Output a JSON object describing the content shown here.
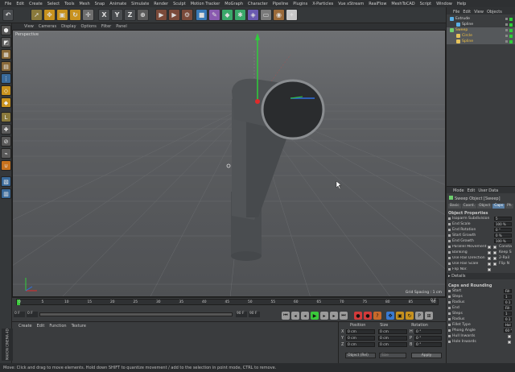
{
  "menu": [
    "File",
    "Edit",
    "Create",
    "Select",
    "Tools",
    "Mesh",
    "Snap",
    "Animate",
    "Simulate",
    "Render",
    "Sculpt",
    "Motion Tracker",
    "MoGraph",
    "Character",
    "Pipeline",
    "Plugins",
    "X-Particles",
    "Vue xStream",
    "RealFlow",
    "MeshToCAD",
    "Script",
    "Window",
    "Help"
  ],
  "toolbar": {
    "axis_x": "X",
    "axis_y": "Y",
    "axis_z": "Z"
  },
  "viewport": {
    "menu": [
      "View",
      "Cameras",
      "Display",
      "Options",
      "Filter",
      "Panel"
    ],
    "label": "Perspective",
    "grid_spacing": "Grid Spacing : 1 cm"
  },
  "object_manager": {
    "menu": [
      "File",
      "Edit",
      "View",
      "Objects"
    ],
    "objects": [
      {
        "name": "Extrude",
        "color": "#5ab0e6",
        "indent": 0,
        "selected": false
      },
      {
        "name": "Spline",
        "color": "#5ab0e6",
        "indent": 1,
        "selected": false
      },
      {
        "name": "Sweep",
        "color": "#6ecf6e",
        "indent": 0,
        "selected": true
      },
      {
        "name": "Circle",
        "color": "#e6c35a",
        "indent": 1,
        "selected": true
      },
      {
        "name": "Spline",
        "color": "#e6c35a",
        "indent": 1,
        "selected": true
      }
    ]
  },
  "attributes": {
    "menu": [
      "Mode",
      "Edit",
      "User Data"
    ],
    "title": "Sweep Object [Sweep]",
    "tabs": [
      "Basic",
      "Coord.",
      "Object",
      "Caps",
      "Ph"
    ],
    "active_tab": "Caps",
    "section_object": "Object Properties",
    "props": [
      {
        "label": "Isoparm Subdivision",
        "value": "5"
      },
      {
        "label": "End Scale",
        "value": "100 %"
      },
      {
        "label": "End Rotation",
        "value": "0 °"
      },
      {
        "label": "Start Growth",
        "value": "0 %"
      },
      {
        "label": "End Growth",
        "value": "100 %"
      }
    ],
    "checks_left": [
      "Parallel Movement",
      "Banking",
      "Use Rail Direction",
      "Use Rail Scale",
      "Flip Nor."
    ],
    "checks_right": [
      "Consta",
      "Keep S",
      "2-Rail",
      "Flip N"
    ],
    "details": "Details",
    "section_caps": "Caps and Rounding",
    "caps": [
      {
        "label": "Start",
        "value": "Fill"
      },
      {
        "label": "Steps",
        "value": "1"
      },
      {
        "label": "Radius",
        "value": "0.1"
      },
      {
        "label": "End",
        "value": "Fill"
      },
      {
        "label": "Steps",
        "value": "1"
      },
      {
        "label": "Radius",
        "value": "0.1"
      },
      {
        "label": "Fillet Type",
        "value": "Hal"
      },
      {
        "label": "Phong Angle",
        "value": "60 °"
      },
      {
        "label": "Hull Inwards",
        "value": ""
      },
      {
        "label": "Hole Inwards",
        "value": ""
      }
    ]
  },
  "timeline": {
    "ticks": [
      "0",
      "5",
      "10",
      "15",
      "20",
      "25",
      "30",
      "35",
      "40",
      "45",
      "50",
      "55",
      "60",
      "65",
      "70",
      "75",
      "80",
      "85",
      "90"
    ],
    "start": "0 F",
    "current": "0 F",
    "end": "90 F",
    "end2": "90 F",
    "frame_readout": "0 F"
  },
  "material_manager": {
    "menu": [
      "Create",
      "Edit",
      "Function",
      "Texture"
    ],
    "brand": "MAXON CINEMA 4D"
  },
  "coordinates": {
    "headers": [
      "Position",
      "Size",
      "Rotation"
    ],
    "rows": [
      {
        "axis": "X",
        "pos": "0 cm",
        "size": "0 cm",
        "rot_axis": "H",
        "rot": "0 °"
      },
      {
        "axis": "Y",
        "pos": "0 cm",
        "size": "0 cm",
        "rot_axis": "P",
        "rot": "0 °"
      },
      {
        "axis": "Z",
        "pos": "0 cm",
        "size": "0 cm",
        "rot_axis": "B",
        "rot": "0 °"
      }
    ],
    "mode": "Object (Rel)",
    "size_mode": "Size",
    "apply": "Apply"
  },
  "status": "Move: Click and drag to move elements. Hold down SHIFT to quantize movement / add to the selection in point mode, CTRL to remove."
}
